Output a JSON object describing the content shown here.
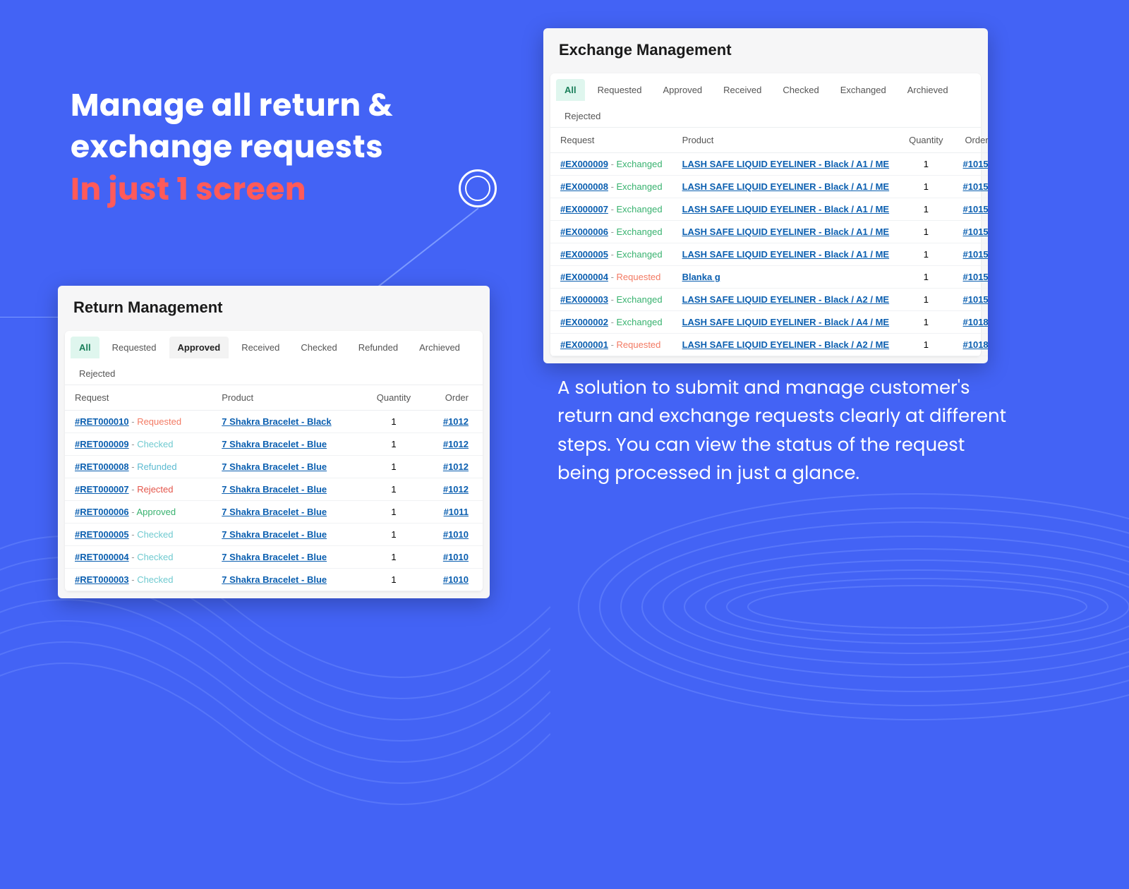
{
  "headline": {
    "line1": "Manage  all return &",
    "line2": "exchange requests",
    "line3": "In just 1 screen"
  },
  "body_copy": "A solution to submit and manage customer's return and exchange requests clearly at different steps. You can view the status of the request being processed in just a glance.",
  "return_panel": {
    "title": "Return Management",
    "tabs": [
      "All",
      "Requested",
      "Approved",
      "Received",
      "Checked",
      "Refunded",
      "Archieved",
      "Rejected"
    ],
    "active_tab": "All",
    "highlight_tab": "Approved",
    "columns": {
      "request": "Request",
      "product": "Product",
      "quantity": "Quantity",
      "order": "Order"
    },
    "rows": [
      {
        "id": "#RET000010",
        "status": "Requested",
        "product": "7 Shakra Bracelet - Black",
        "qty": 1,
        "order": "#1012"
      },
      {
        "id": "#RET000009",
        "status": "Checked",
        "product": "7 Shakra Bracelet - Blue",
        "qty": 1,
        "order": "#1012"
      },
      {
        "id": "#RET000008",
        "status": "Refunded",
        "product": "7 Shakra Bracelet - Blue",
        "qty": 1,
        "order": "#1012"
      },
      {
        "id": "#RET000007",
        "status": "Rejected",
        "product": "7 Shakra Bracelet - Blue",
        "qty": 1,
        "order": "#1012"
      },
      {
        "id": "#RET000006",
        "status": "Approved",
        "product": "7 Shakra Bracelet - Blue",
        "qty": 1,
        "order": "#1011"
      },
      {
        "id": "#RET000005",
        "status": "Checked",
        "product": "7 Shakra Bracelet - Blue",
        "qty": 1,
        "order": "#1010"
      },
      {
        "id": "#RET000004",
        "status": "Checked",
        "product": "7 Shakra Bracelet - Blue",
        "qty": 1,
        "order": "#1010"
      },
      {
        "id": "#RET000003",
        "status": "Checked",
        "product": "7 Shakra Bracelet - Blue",
        "qty": 1,
        "order": "#1010"
      }
    ]
  },
  "exchange_panel": {
    "title": "Exchange Management",
    "tabs": [
      "All",
      "Requested",
      "Approved",
      "Received",
      "Checked",
      "Exchanged",
      "Archieved",
      "Rejected"
    ],
    "active_tab": "All",
    "columns": {
      "request": "Request",
      "product": "Product",
      "quantity": "Quantity",
      "order": "Order"
    },
    "rows": [
      {
        "id": "#EX000009",
        "status": "Exchanged",
        "product": "LASH SAFE LIQUID EYELINER - Black / A1 / ME",
        "qty": 1,
        "order": "#1015"
      },
      {
        "id": "#EX000008",
        "status": "Exchanged",
        "product": "LASH SAFE LIQUID EYELINER - Black / A1 / ME",
        "qty": 1,
        "order": "#1015"
      },
      {
        "id": "#EX000007",
        "status": "Exchanged",
        "product": "LASH SAFE LIQUID EYELINER - Black / A1 / ME",
        "qty": 1,
        "order": "#1015"
      },
      {
        "id": "#EX000006",
        "status": "Exchanged",
        "product": "LASH SAFE LIQUID EYELINER - Black / A1 / ME",
        "qty": 1,
        "order": "#1015"
      },
      {
        "id": "#EX000005",
        "status": "Exchanged",
        "product": "LASH SAFE LIQUID EYELINER - Black / A1 / ME",
        "qty": 1,
        "order": "#1015"
      },
      {
        "id": "#EX000004",
        "status": "Requested",
        "product": "Blanka g",
        "qty": 1,
        "order": "#1015"
      },
      {
        "id": "#EX000003",
        "status": "Exchanged",
        "product": "LASH SAFE LIQUID EYELINER - Black / A2 / ME",
        "qty": 1,
        "order": "#1015"
      },
      {
        "id": "#EX000002",
        "status": "Exchanged",
        "product": "LASH SAFE LIQUID EYELINER - Black / A4 / ME",
        "qty": 1,
        "order": "#1018"
      },
      {
        "id": "#EX000001",
        "status": "Requested",
        "product": "LASH SAFE LIQUID EYELINER - Black / A2 / ME",
        "qty": 1,
        "order": "#1018"
      }
    ]
  }
}
